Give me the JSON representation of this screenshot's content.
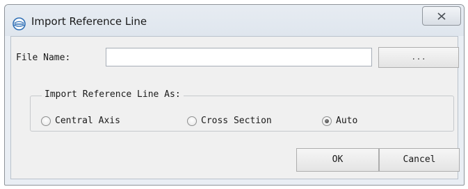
{
  "window": {
    "title": "Import Reference Line",
    "app_icon": "globe-icon",
    "close_icon": "close-x-icon"
  },
  "form": {
    "file_name_label": "File Name:",
    "file_name_value": "",
    "browse_label": "...",
    "group_label": "Import Reference Line As:",
    "options": [
      {
        "label": "Central Axis",
        "selected": false
      },
      {
        "label": "Cross Section",
        "selected": false
      },
      {
        "label": "Auto",
        "selected": true
      }
    ]
  },
  "buttons": {
    "ok": "OK",
    "cancel": "Cancel"
  },
  "colors": {
    "title_bar": "#dfe6ee",
    "dialog_body": "#f0f0f0",
    "icon_blue": "#2f6fb5"
  }
}
